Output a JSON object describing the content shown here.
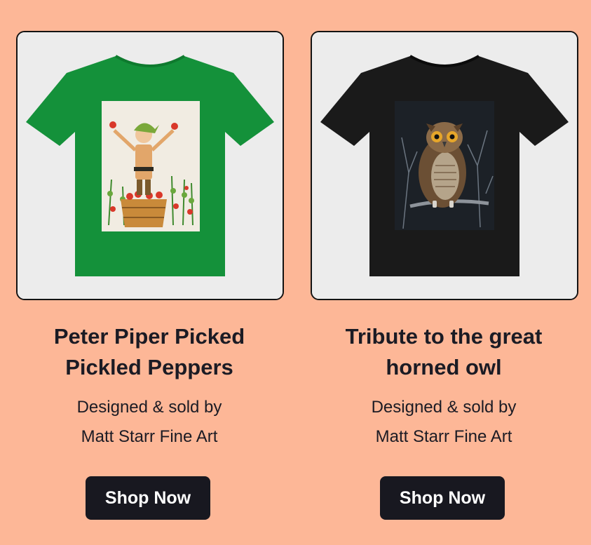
{
  "colors": {
    "background": "#fdb797",
    "card_image_bg": "#ececec",
    "button_bg": "#181820",
    "button_text": "#ffffff",
    "text": "#1b1b24"
  },
  "products": [
    {
      "title_line1": "Peter Piper Picked",
      "title_line2": "Pickled Peppers",
      "byline_line1": "Designed & sold by",
      "byline_line2": "Matt Starr Fine Art",
      "button_label": "Shop Now",
      "shirt_color": "green",
      "artwork": "peter-piper-illustration"
    },
    {
      "title_line1": "Tribute to the great",
      "title_line2": "horned owl",
      "byline_line1": "Designed & sold by",
      "byline_line2": "Matt Starr Fine Art",
      "button_label": "Shop Now",
      "shirt_color": "black",
      "artwork": "great-horned-owl-painting"
    }
  ]
}
